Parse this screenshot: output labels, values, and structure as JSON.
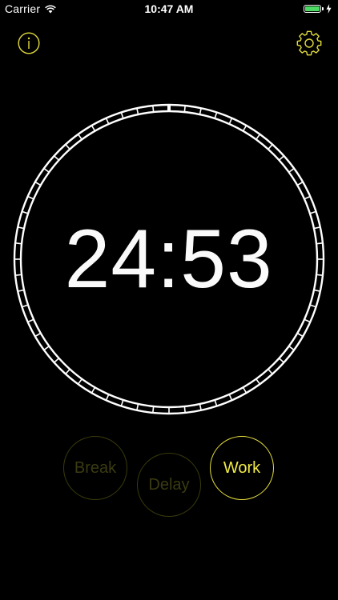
{
  "status_bar": {
    "carrier": "Carrier",
    "time": "10:47 AM",
    "battery_color": "#4cd964"
  },
  "header": {
    "info_icon": "info-icon",
    "settings_icon": "gear-icon",
    "accent_color": "#e3dd3a"
  },
  "timer": {
    "display": "24:53"
  },
  "modes": {
    "break_label": "Break",
    "delay_label": "Delay",
    "work_label": "Work",
    "active": "Work"
  }
}
